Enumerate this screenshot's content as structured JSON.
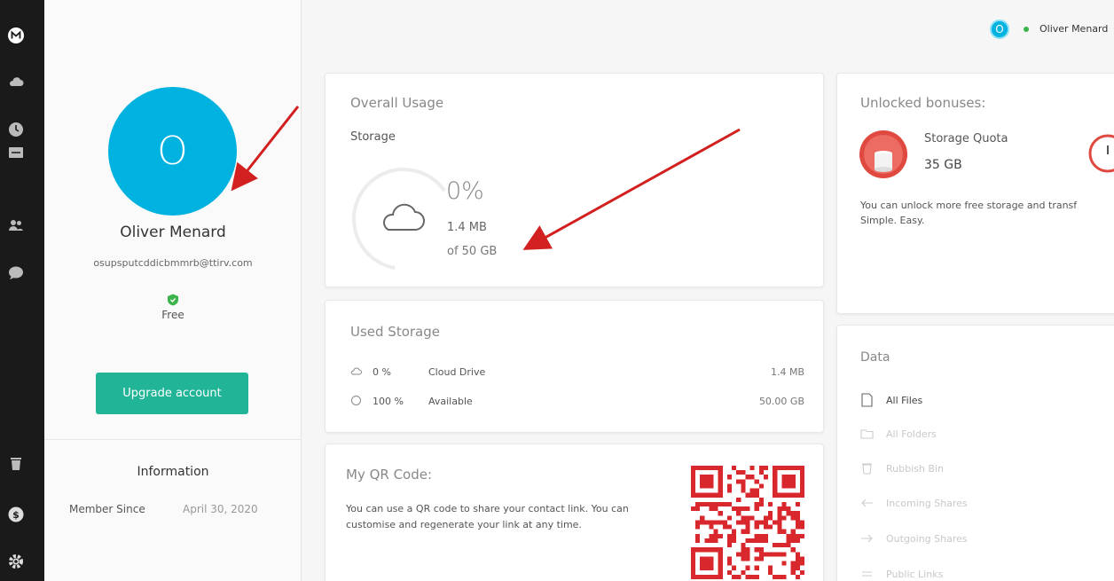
{
  "colors": {
    "accent": "#00b2e0",
    "upgrade": "#22b497",
    "mega_red": "#d9272e",
    "status_online": "#3bb54a",
    "arrow": "#d21f1f"
  },
  "icons": {
    "rail": [
      "mega-logo-icon",
      "cloud-drive-icon",
      "recents-icon",
      "transfers-icon",
      "contacts-icon",
      "chat-icon",
      "rubbish-bin-icon",
      "achievements-icon",
      "settings-icon"
    ],
    "data": [
      "file-icon",
      "folder-icon",
      "bin-icon",
      "incoming-share-icon",
      "outgoing-share-icon",
      "link-icon"
    ]
  },
  "header": {
    "avatar_initial": "O",
    "user_name": "Oliver Menard"
  },
  "profile": {
    "avatar_initial": "O",
    "name": "Oliver Menard",
    "email": "osupsputcddicbmmrb@ttirv.com",
    "plan": "Free",
    "upgrade_label": "Upgrade account",
    "information_title": "Information",
    "member_since_label": "Member Since",
    "member_since_value": "April 30, 2020"
  },
  "overall_usage": {
    "title": "Overall Usage",
    "storage_label": "Storage",
    "percent": "0%",
    "used": "1.4 MB",
    "total": "of 50 GB",
    "fill_fraction": 0
  },
  "used_storage": {
    "title": "Used Storage",
    "rows": [
      {
        "percent": "0 %",
        "label": "Cloud Drive",
        "size": "1.4 MB"
      },
      {
        "percent": "100 %",
        "label": "Available",
        "size": "50.00 GB"
      }
    ]
  },
  "qr": {
    "title": "My QR Code:",
    "description": "You can use a QR code to share your contact link. You can customise and regenerate your link at any time."
  },
  "bonuses": {
    "title": "Unlocked bonuses:",
    "item_label": "Storage Quota",
    "item_value": "35 GB",
    "description_line1": "You can unlock more free storage and transf",
    "description_line2": "Simple. Easy."
  },
  "data": {
    "title": "Data",
    "items": [
      "All Files",
      "All Folders",
      "Rubbish Bin",
      "Incoming Shares",
      "Outgoing Shares",
      "Public Links"
    ]
  }
}
